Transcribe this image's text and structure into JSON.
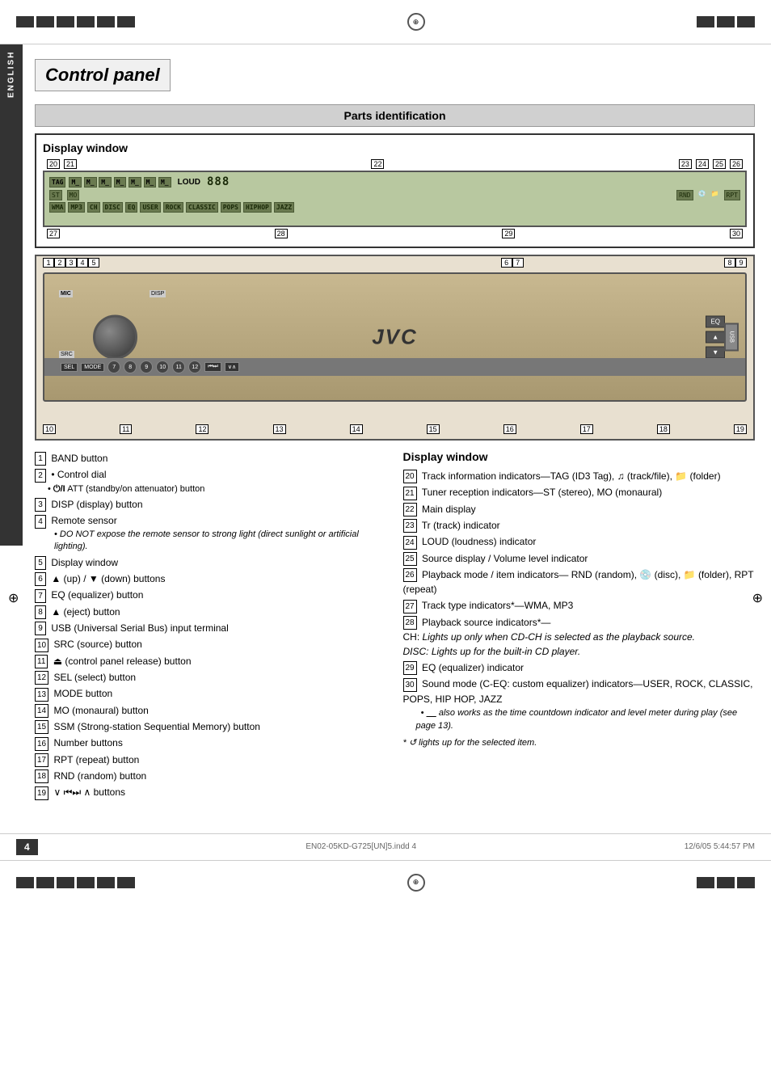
{
  "page": {
    "title": "Control panel",
    "section": "Parts identification",
    "page_number": "4",
    "footer_file": "EN02-05KD-G725[UN]5.indd  4",
    "footer_date": "12/6/05  5:44:57 PM",
    "language": "ENGLISH"
  },
  "display_window": {
    "title": "Display window",
    "number_labels_top": [
      "20",
      "21",
      "22",
      "23",
      "24",
      "25",
      "26"
    ],
    "number_labels_bottom": [
      "27",
      "28",
      "29",
      "30"
    ],
    "lcd_segments": [
      "TAG",
      "ST MO",
      "WMA",
      "MP3",
      "CH",
      "DISC",
      "EQ",
      "USER",
      "ROCK",
      "CLASSIC",
      "POPS",
      "HIPHOP",
      "JAZZ",
      "RND",
      "RPT",
      "LOUD"
    ]
  },
  "control_panel_numbers": {
    "top": [
      "1",
      "2",
      "3",
      "4",
      "5",
      "6",
      "7",
      "8",
      "9"
    ],
    "bottom": [
      "10",
      "11",
      "12",
      "13",
      "14",
      "15",
      "16",
      "17",
      "18",
      "19"
    ]
  },
  "parts_left": [
    {
      "num": "1",
      "text": "BAND button"
    },
    {
      "num": "2",
      "text": "• Control dial",
      "sub": "• ⏻/I ATT (standby/on attenuator) button"
    },
    {
      "num": "3",
      "text": "DISP (display) button"
    },
    {
      "num": "4",
      "text": "Remote sensor",
      "italic": "• DO NOT expose the remote sensor to strong light (direct sunlight or artificial lighting)."
    },
    {
      "num": "5",
      "text": "Display window"
    },
    {
      "num": "6",
      "text": "▲ (up) / ▼ (down) buttons"
    },
    {
      "num": "7",
      "text": "EQ (equalizer) button"
    },
    {
      "num": "8",
      "text": "▲ (eject) button"
    },
    {
      "num": "9",
      "text": "USB (Universal Serial Bus) input terminal"
    },
    {
      "num": "10",
      "text": "SRC (source) button"
    },
    {
      "num": "11",
      "text": "⏏ (control panel release) button"
    },
    {
      "num": "12",
      "text": "SEL (select) button"
    },
    {
      "num": "13",
      "text": "MODE button"
    },
    {
      "num": "14",
      "text": "MO (monaural) button"
    },
    {
      "num": "15",
      "text": "SSM (Strong-station Sequential Memory) button"
    },
    {
      "num": "16",
      "text": "Number buttons"
    },
    {
      "num": "17",
      "text": "RPT (repeat) button"
    },
    {
      "num": "18",
      "text": "RND (random) button"
    },
    {
      "num": "19",
      "text": "∨ ⏮⏭ ∧ buttons"
    }
  ],
  "display_window_right": {
    "title": "Display window",
    "items": [
      {
        "num": "20",
        "text": "Track information indicators—TAG (ID3 Tag), 🎵 (track/file), 📁 (folder)"
      },
      {
        "num": "21",
        "text": "Tuner reception indicators—ST (stereo), MO (monaural)"
      },
      {
        "num": "22",
        "text": "Main display"
      },
      {
        "num": "23",
        "text": "Tr (track) indicator"
      },
      {
        "num": "24",
        "text": "LOUD (loudness) indicator"
      },
      {
        "num": "25",
        "text": "Source display / Volume level indicator"
      },
      {
        "num": "26",
        "text": "Playback mode / item indicators— RND (random), 💿 (disc), 📁 (folder), RPT (repeat)"
      },
      {
        "num": "27",
        "text": "Track type indicators*—WMA, MP3"
      },
      {
        "num": "28",
        "text": "Playback source indicators*— CH: Lights up only when CD-CH is selected as the playback source.",
        "italic2": "DISC: Lights up for the built-in CD player."
      },
      {
        "num": "29",
        "text": "EQ (equalizer) indicator"
      },
      {
        "num": "30",
        "text": "Sound mode (C-EQ: custom equalizer) indicators—USER, ROCK, CLASSIC, POPS, HIP HOP, JAZZ",
        "bullet": "• ___ also works as the time countdown indicator and level meter during play (see page 13)."
      }
    ],
    "asterisk_note": "* ↺ lights up for the selected item."
  }
}
